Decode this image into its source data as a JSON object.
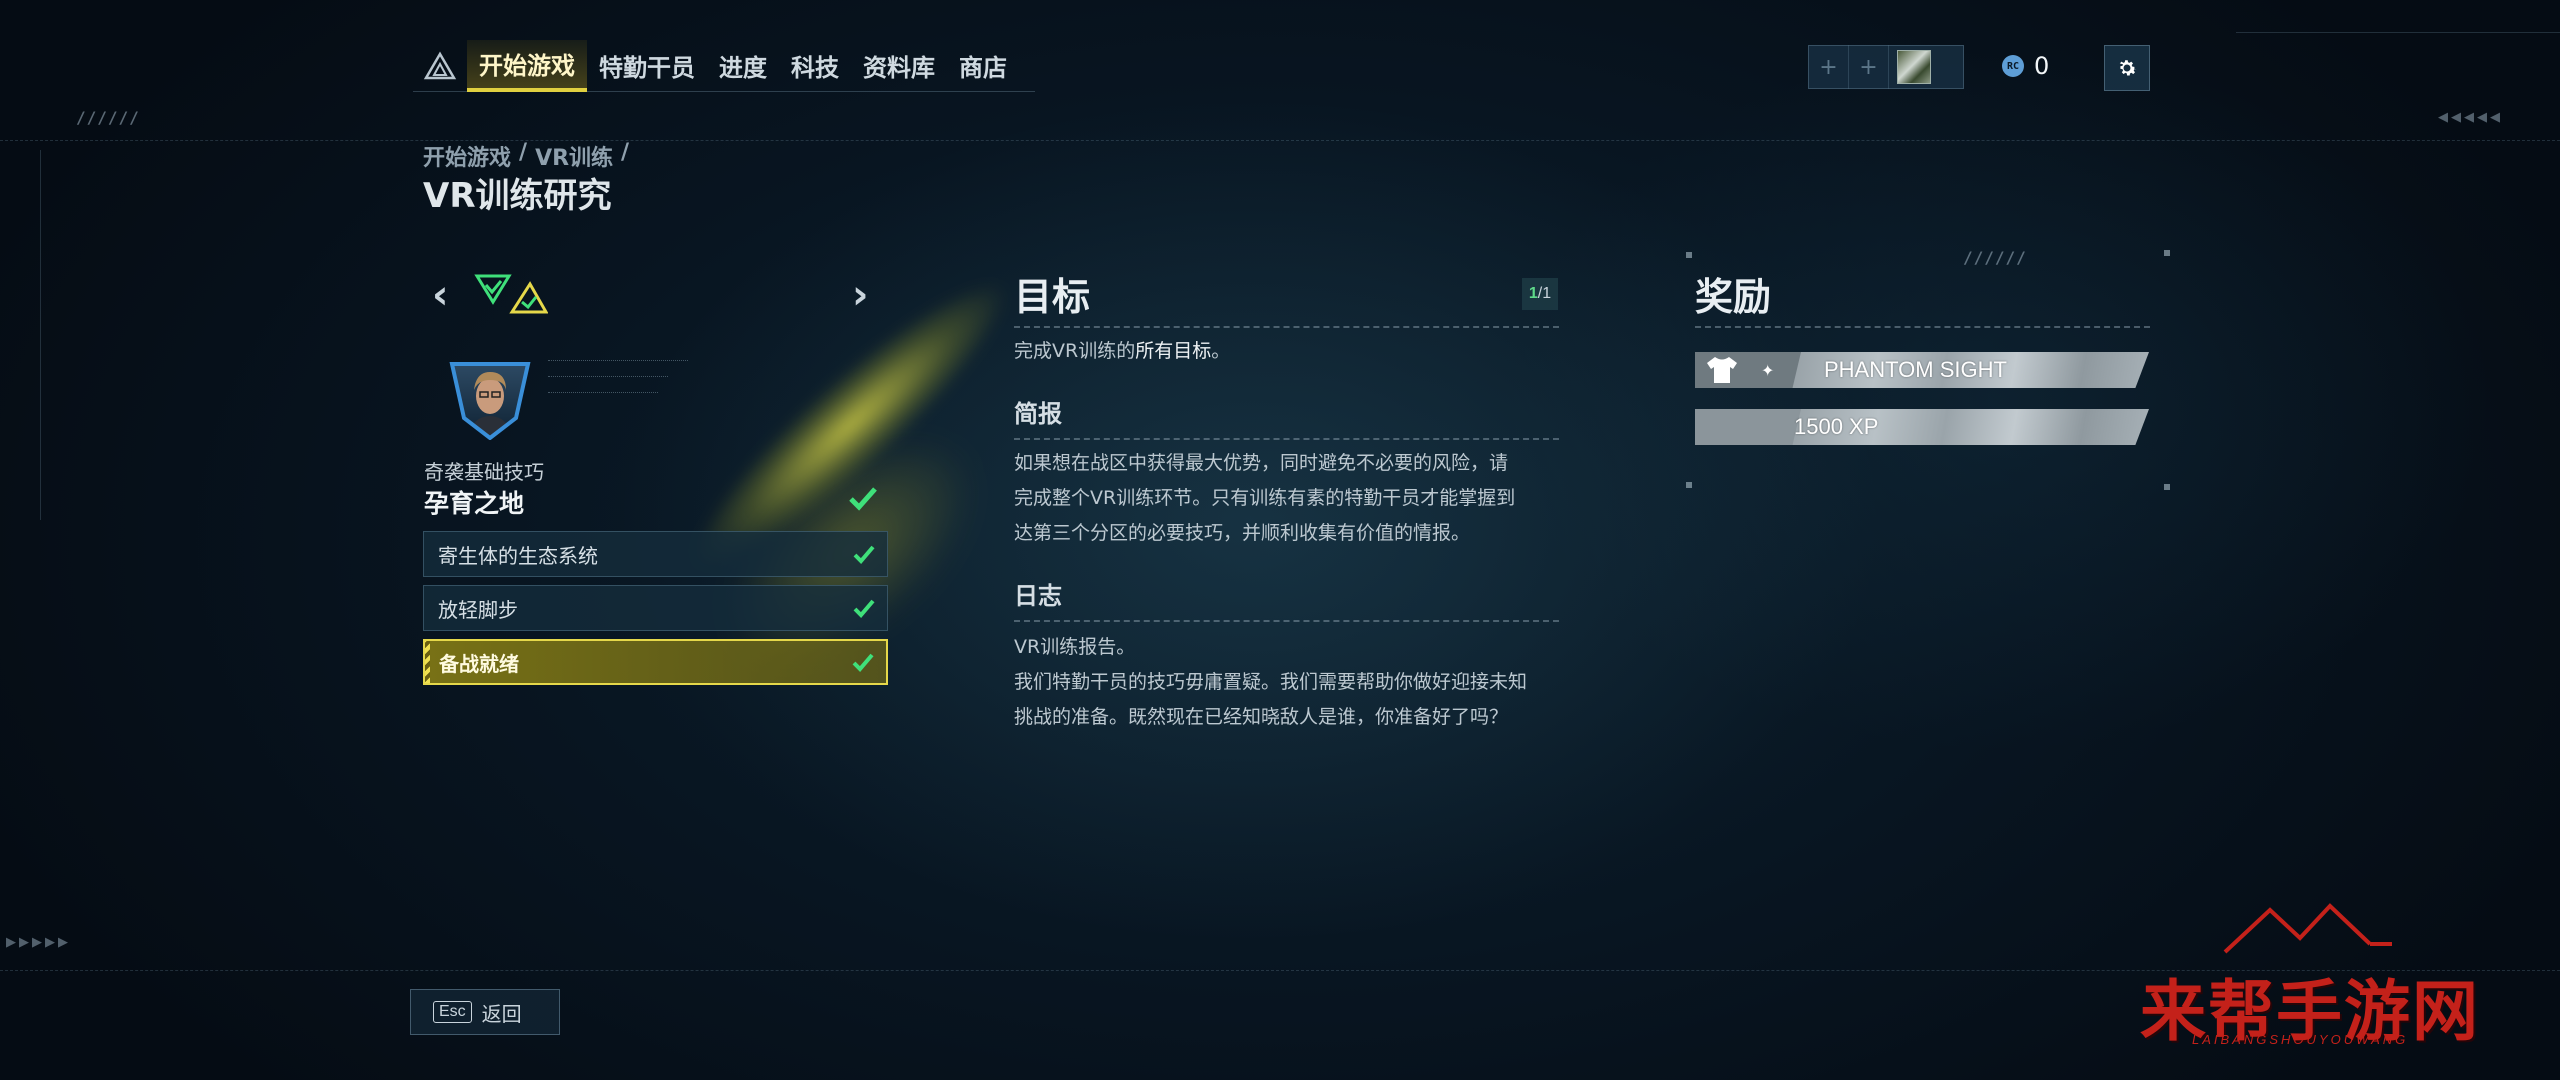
{
  "nav": {
    "logo_icon": "agent-triangle-logo-icon",
    "tabs": [
      {
        "label": "开始游戏",
        "active": true
      },
      {
        "label": "特勤干员",
        "active": false
      },
      {
        "label": "进度",
        "active": false
      },
      {
        "label": "科技",
        "active": false
      },
      {
        "label": "资料库",
        "active": false
      },
      {
        "label": "商店",
        "active": false
      }
    ]
  },
  "topright": {
    "party_slot_icon": "plus-icon",
    "currency_icon_text": "RC",
    "currency_value": "0",
    "settings_icon": "gear-icon"
  },
  "breadcrumb": {
    "items": [
      "开始游戏",
      "/",
      "VR训练",
      "/"
    ],
    "title": "VR训练研究"
  },
  "mission": {
    "category": "奇袭基础技巧",
    "name": "孕育之地",
    "objectives": [
      {
        "label": "寄生体的生态系统",
        "done": true,
        "active": false
      },
      {
        "label": "放轻脚步",
        "done": true,
        "active": false
      },
      {
        "label": "备战就绪",
        "done": true,
        "active": true
      }
    ]
  },
  "goal": {
    "title": "目标",
    "counter_done": "1",
    "counter_total": "/1",
    "text_prefix": "完成VR训练的",
    "text_bold": "所有目标",
    "text_suffix": "。",
    "brief_title": "简报",
    "brief_lines": [
      "如果想在战区中获得最大优势，同时避免不必要的风险，请",
      "完成整个VR训练环节。只有训练有素的特勤干员才能掌握到",
      "达第三个分区的必要技巧，并顺利收集有价值的情报。"
    ],
    "log_title": "日志",
    "log_lines": [
      "VR训练报告。",
      "我们特勤干员的技巧毋庸置疑。我们需要帮助你做好迎接未知",
      "挑战的准备。既然现在已经知晓敌人是谁，你准备好了吗？"
    ]
  },
  "rewards": {
    "title": "奖励",
    "items": [
      {
        "label": "PHANTOM SIGHT",
        "icon": "shirt-icon"
      },
      {
        "label": "1500 XP",
        "icon": ""
      }
    ]
  },
  "footer": {
    "esc_key": "Esc",
    "back_label": "返回"
  },
  "watermark": {
    "text": "来帮手游网",
    "sub": "LAIBANGSHOUYOUWANG"
  },
  "colors": {
    "accent_yellow": "#e5d84a",
    "check_green": "#3fe07a",
    "agent_blue": "#3a8fd9",
    "bg_dark": "#081521"
  }
}
